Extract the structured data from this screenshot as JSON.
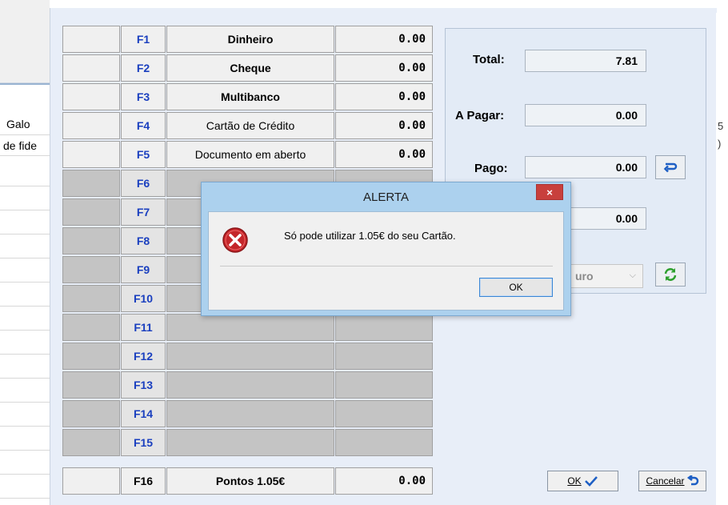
{
  "background_app": {
    "rows": [
      "Galo",
      "de fide"
    ],
    "right_fragments": [
      "5",
      ")"
    ]
  },
  "payment_grid": {
    "rows": [
      {
        "key": "F1",
        "method": "Dinheiro",
        "amount": "0.00"
      },
      {
        "key": "F2",
        "method": "Cheque",
        "amount": "0.00"
      },
      {
        "key": "F3",
        "method": "Multibanco",
        "amount": "0.00"
      },
      {
        "key": "F4",
        "method": "Cartão de Crédito",
        "amount": "0.00"
      },
      {
        "key": "F5",
        "method": "Documento em aberto",
        "amount": "0.00"
      },
      {
        "key": "F6",
        "method": "",
        "amount": ""
      },
      {
        "key": "F7",
        "method": "",
        "amount": ""
      },
      {
        "key": "F8",
        "method": "",
        "amount": ""
      },
      {
        "key": "F9",
        "method": "",
        "amount": ""
      },
      {
        "key": "F10",
        "method": "",
        "amount": ""
      },
      {
        "key": "F11",
        "method": "",
        "amount": ""
      },
      {
        "key": "F12",
        "method": "",
        "amount": ""
      },
      {
        "key": "F13",
        "method": "",
        "amount": ""
      },
      {
        "key": "F14",
        "method": "",
        "amount": ""
      },
      {
        "key": "F15",
        "method": "",
        "amount": ""
      },
      {
        "key": "F16",
        "method": "Pontos 1.05€",
        "amount": "0.00"
      }
    ]
  },
  "totals": {
    "total_label": "Total:",
    "total_value": "7.81",
    "a_pagar_label": "A Pagar:",
    "a_pagar_value": "0.00",
    "pago_label": "Pago:",
    "pago_value": "0.00",
    "troco_value": "0.00",
    "currency_partial": "uro"
  },
  "buttons": {
    "ok_label": "OK",
    "cancel_label": "Cancelar"
  },
  "alert": {
    "title": "ALERTA",
    "close_glyph": "×",
    "message": "Só pode utilizar 1.05€ do seu Cartão.",
    "ok_label": "OK"
  },
  "colors": {
    "key_blue": "#1a3fbf",
    "panel_bg": "#e3ebf6",
    "alert_frame": "#acd1ee",
    "close_red": "#c8403c"
  }
}
